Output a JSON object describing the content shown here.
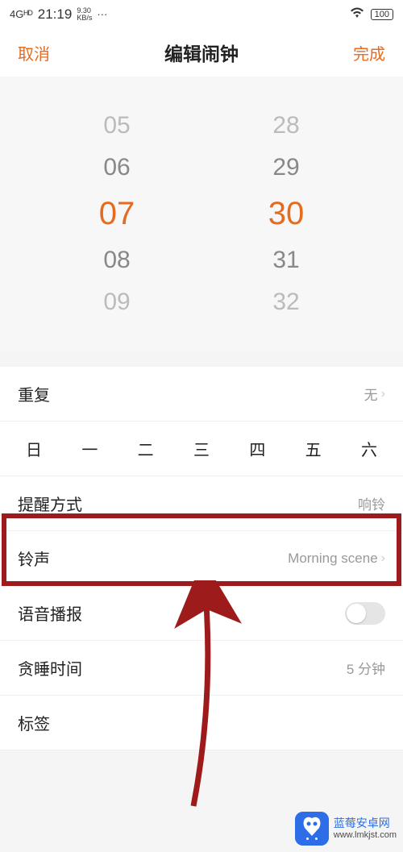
{
  "status": {
    "network": "4Gᴴᴰ",
    "time": "21:19",
    "speed_top": "9.30",
    "speed_bot": "KB/s",
    "more": "···",
    "battery": "100"
  },
  "nav": {
    "cancel": "取消",
    "title": "编辑闹钟",
    "done": "完成"
  },
  "picker": {
    "hours": [
      "05",
      "06",
      "07",
      "08",
      "09"
    ],
    "minutes": [
      "28",
      "29",
      "30",
      "31",
      "32"
    ],
    "selected_index": 2
  },
  "settings": {
    "repeat": {
      "label": "重复",
      "value": "无"
    },
    "weekdays": [
      "日",
      "一",
      "二",
      "三",
      "四",
      "五",
      "六"
    ],
    "alert_mode": {
      "label": "提醒方式",
      "value": "响铃"
    },
    "ringtone": {
      "label": "铃声",
      "value": "Morning scene"
    },
    "voice": {
      "label": "语音播报",
      "on": false
    },
    "snooze": {
      "label": "贪睡时间",
      "value": "5 分钟"
    },
    "tag": {
      "label": "标签"
    }
  },
  "watermark": {
    "title": "蓝莓安卓网",
    "url": "www.lmkjst.com"
  }
}
